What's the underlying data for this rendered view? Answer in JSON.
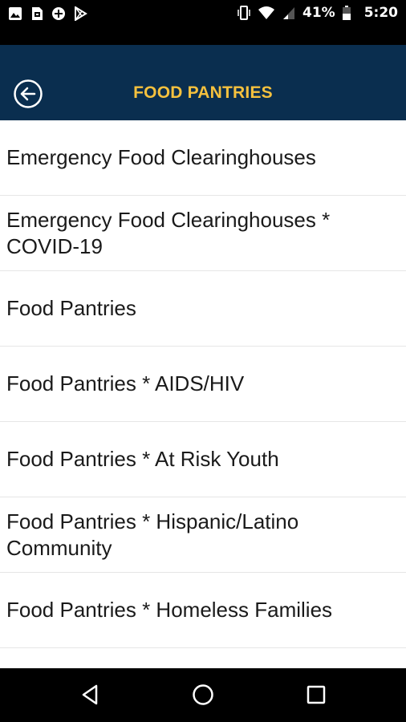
{
  "status_bar": {
    "battery_percent": "41%",
    "time": "5:20",
    "left_icons": [
      "image-icon",
      "sim-message-icon",
      "plus-circle-icon",
      "play-store-icon"
    ],
    "right_icons": [
      "vibrate-icon",
      "wifi-icon",
      "signal-icon",
      "battery-icon"
    ]
  },
  "header": {
    "title": "FOOD PANTRIES",
    "back_icon": "back-arrow-circle-icon",
    "background_color": "#0a2e4f",
    "title_color": "#f5c13e"
  },
  "list": {
    "items": [
      {
        "label": "Emergency Food Clearinghouses"
      },
      {
        "label": "Emergency Food Clearinghouses * COVID-19"
      },
      {
        "label": "Food Pantries"
      },
      {
        "label": "Food Pantries * AIDS/HIV"
      },
      {
        "label": "Food Pantries * At Risk Youth"
      },
      {
        "label": "Food Pantries * Hispanic/Latino Community"
      },
      {
        "label": "Food Pantries * Homeless Families"
      },
      {
        "label": ""
      }
    ]
  },
  "nav_bar": {
    "icons": [
      "nav-back-icon",
      "nav-home-icon",
      "nav-recents-icon"
    ]
  }
}
